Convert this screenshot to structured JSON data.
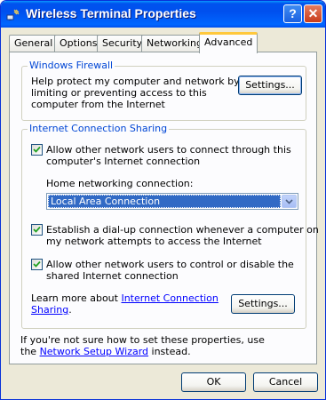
{
  "window": {
    "title": "Wireless Terminal Properties",
    "help_glyph": "?",
    "close_glyph": "✕",
    "accent_color": "#0054e3"
  },
  "tabs": [
    {
      "label": "General",
      "active": false
    },
    {
      "label": "Options",
      "active": false
    },
    {
      "label": "Security",
      "active": false
    },
    {
      "label": "Networking",
      "active": false
    },
    {
      "label": "Advanced",
      "active": true
    }
  ],
  "firewall": {
    "title": "Windows Firewall",
    "description_lines": [
      "Help protect my computer and network by",
      "limiting or preventing access to this",
      "computer from the Internet"
    ],
    "settings_button": "Settings..."
  },
  "ics": {
    "title": "Internet Connection Sharing",
    "allow_connect_lines": [
      "Allow other network users to connect through this",
      "computer's Internet connection"
    ],
    "allow_connect_checked": true,
    "home_network_label": "Home networking connection:",
    "home_network_value": "Local Area Connection",
    "dialup_lines": [
      "Establish a dial-up connection whenever a computer on",
      "my network attempts to access the Internet"
    ],
    "dialup_checked": true,
    "allow_control_lines": [
      "Allow other network users to control or disable the",
      "shared Internet connection"
    ],
    "allow_control_checked": true,
    "learn_more_prefix": "Learn more about ",
    "learn_more_link_line1": "Internet Connection",
    "learn_more_link_line2": "Sharing",
    "learn_more_suffix": ".",
    "settings_button": "Settings..."
  },
  "footer": {
    "note_line1": "If you're not sure how to set these properties, use",
    "note_prefix": "the ",
    "wizard_link": "Network Setup Wizard",
    "note_suffix": " instead."
  },
  "buttons": {
    "ok": "OK",
    "cancel": "Cancel"
  }
}
